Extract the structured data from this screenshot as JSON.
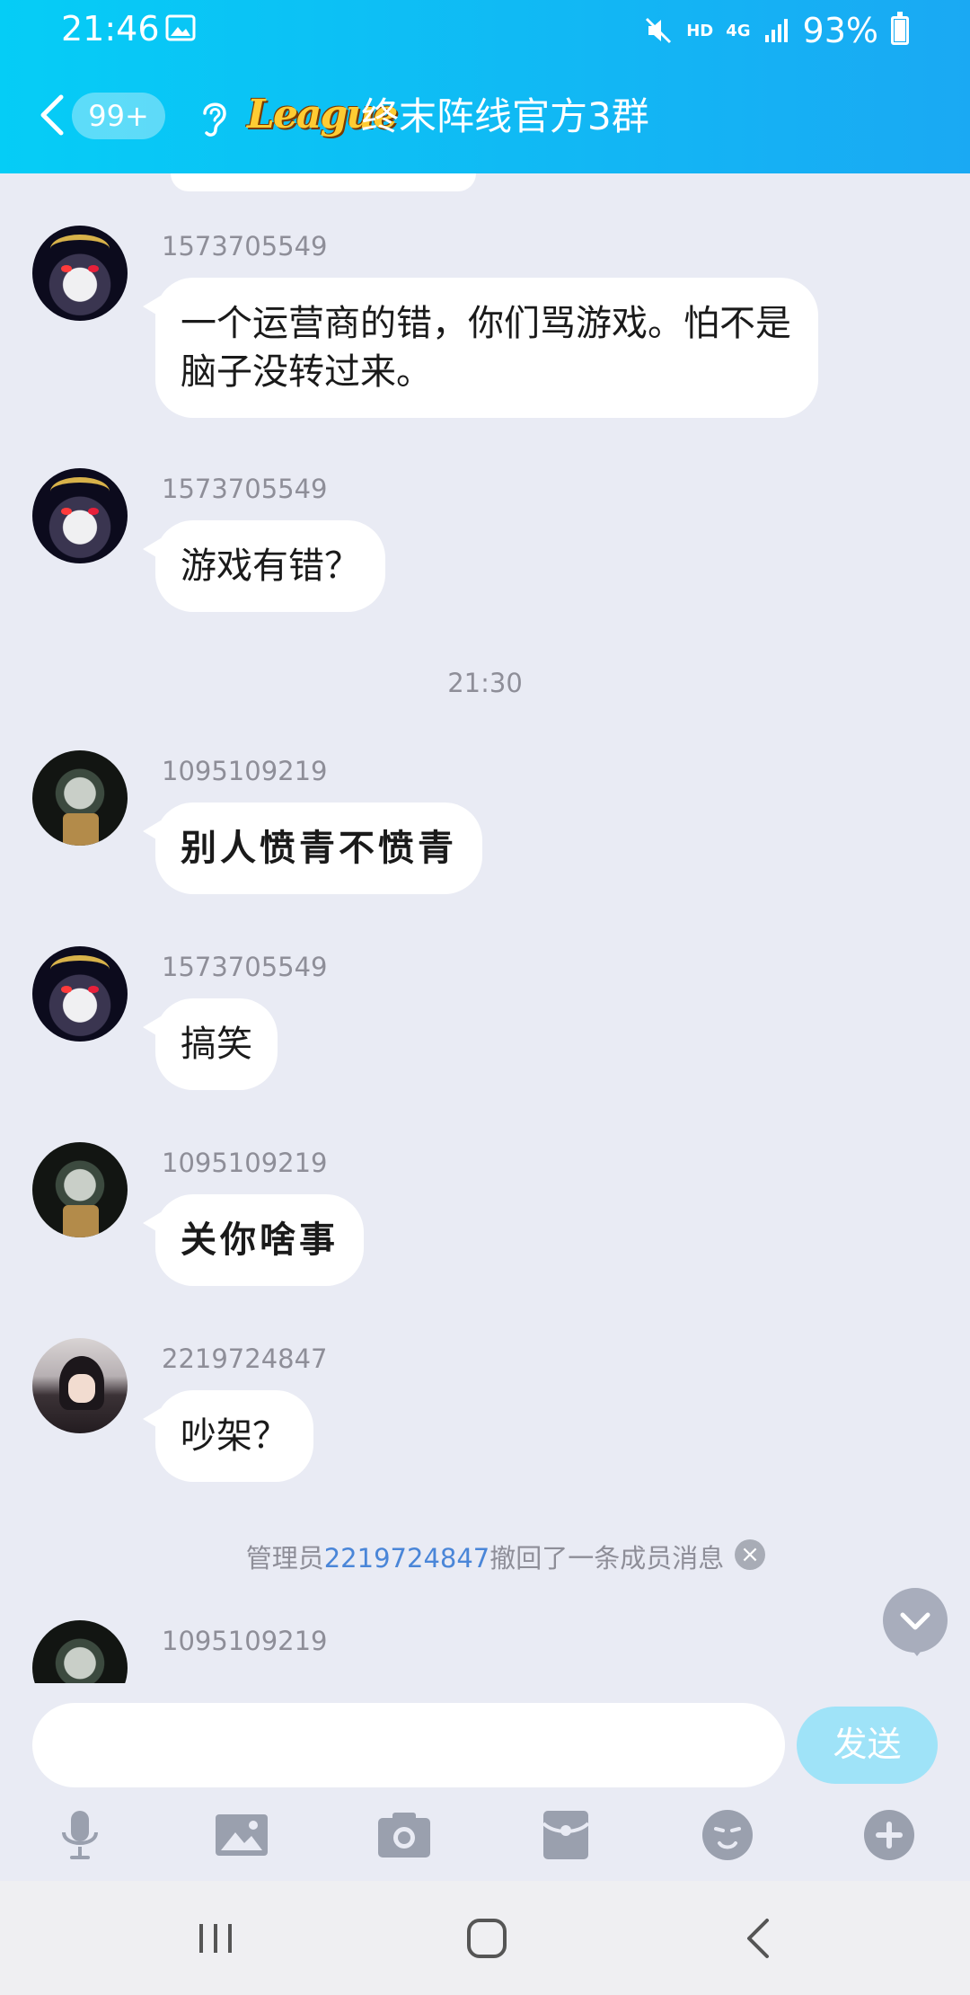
{
  "status_bar": {
    "time": "21:46",
    "hd": "HD",
    "network": "4G",
    "battery": "93%",
    "icons": [
      "image-icon",
      "mute-icon",
      "signal-icon",
      "battery-icon"
    ]
  },
  "header": {
    "unread_count": "99+",
    "logo_text": "League",
    "group_name": "终末阵线官方3群",
    "background_color": "#05cdf6"
  },
  "messages": [
    {
      "sender": "1573705549",
      "text": "一个运营商的错，你们骂游戏。怕不是脑子没转过来。",
      "avatar": "skull-avatar"
    },
    {
      "sender": "1573705549",
      "text": "游戏有错？",
      "avatar": "skull-avatar"
    },
    {
      "time_separator": "21:30"
    },
    {
      "sender": "1095109219",
      "text": "别人愤青不愤青",
      "avatar": "mask-avatar"
    },
    {
      "sender": "1573705549",
      "text": "搞笑",
      "avatar": "skull-avatar"
    },
    {
      "sender": "1095109219",
      "text": "关你啥事",
      "avatar": "mask-avatar"
    },
    {
      "sender": "2219724847",
      "text": "吵架？",
      "avatar": "girl-avatar"
    },
    {
      "sender": "1095109219",
      "text": "",
      "avatar": "mask-avatar"
    }
  ],
  "system_note": {
    "prefix": "管理员",
    "admin_id": "2219724847",
    "suffix": "撤回了一条成员消息"
  },
  "input": {
    "placeholder": "",
    "value": "",
    "send_label": "发送"
  },
  "toolbar": [
    "microphone-icon",
    "picture-icon",
    "camera-icon",
    "red-packet-icon",
    "emoji-icon",
    "plus-icon"
  ],
  "nav": [
    "recent-apps-button",
    "home-button",
    "back-button"
  ]
}
